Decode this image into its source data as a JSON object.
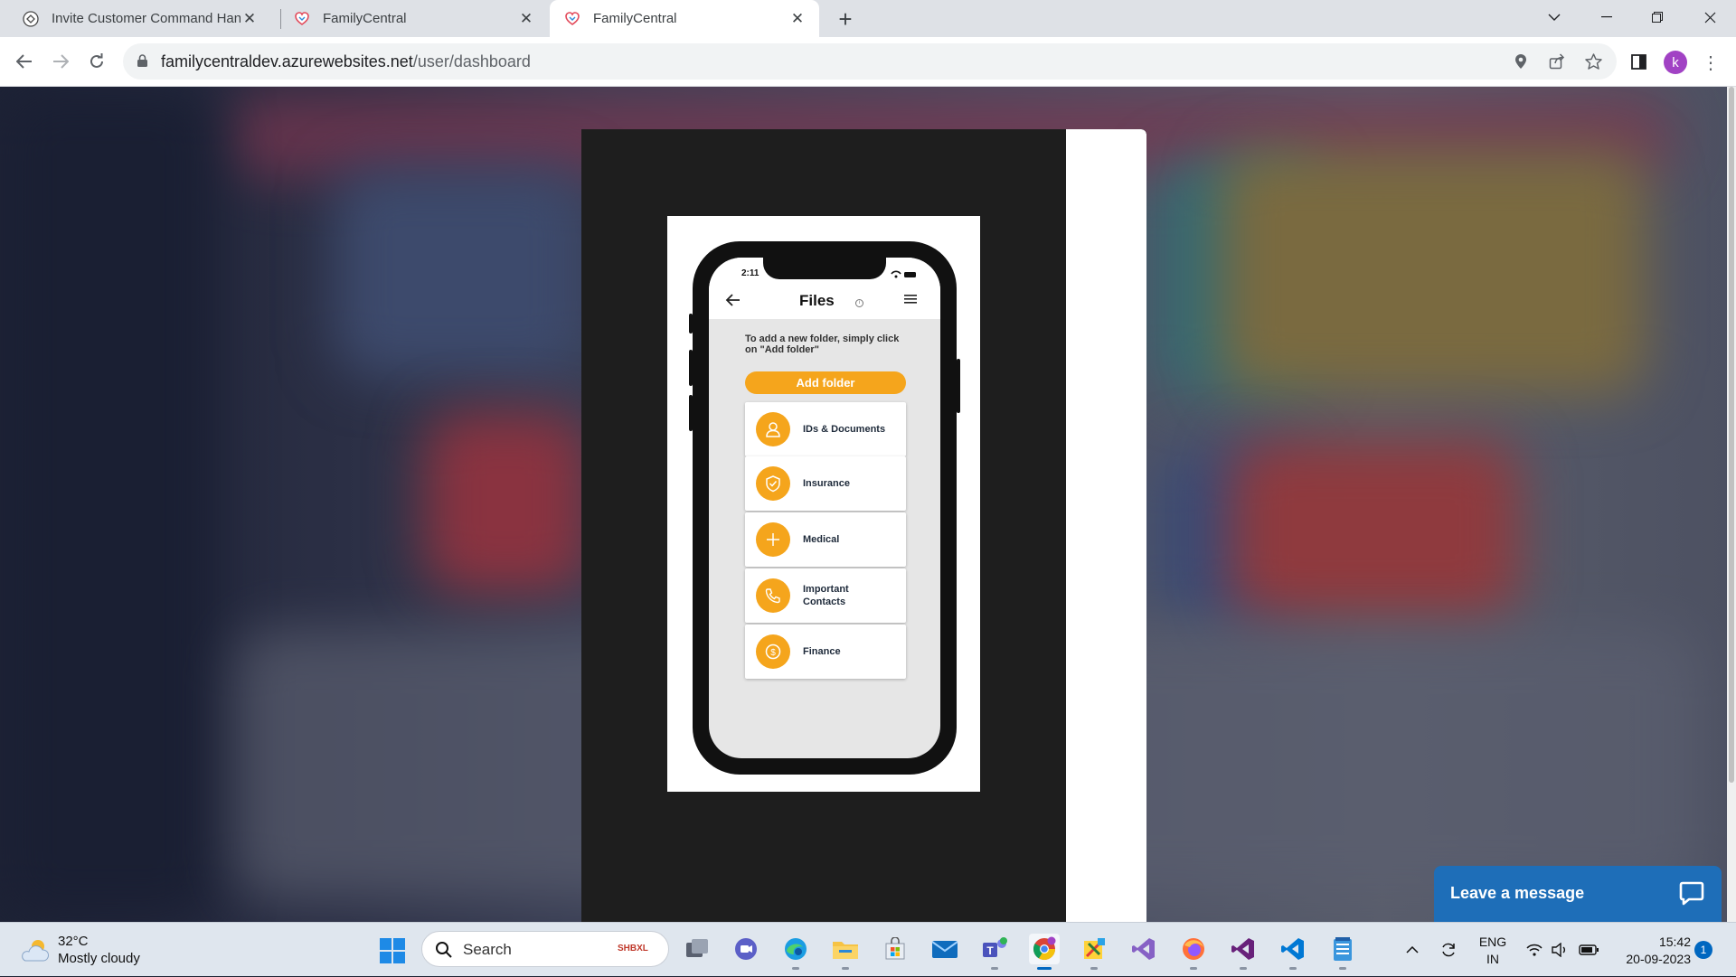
{
  "browser": {
    "tabs": [
      {
        "title": "Invite Customer Command Hand",
        "favicon": "chatgpt-icon",
        "active": false
      },
      {
        "title": "FamilyCentral",
        "favicon": "familycentral-heart-icon",
        "active": false
      },
      {
        "title": "FamilyCentral",
        "favicon": "familycentral-heart-icon",
        "active": true
      }
    ],
    "new_tab_label": "+",
    "url_host": "familycentraldev.azurewebsites.net",
    "url_path": "/user/dashboard",
    "profile_initial": "k"
  },
  "phone": {
    "time": "2:11",
    "title": "Files",
    "hint": "To add a new folder, simply click on \"Add folder\"",
    "add_folder_label": "Add folder",
    "folders": [
      {
        "label": "IDs & Documents",
        "icon": "person-icon"
      },
      {
        "label": "Insurance",
        "icon": "shield-check-icon"
      },
      {
        "label": "Medical",
        "icon": "plus-icon"
      },
      {
        "label": "Important Contacts",
        "icon": "phone-icon"
      },
      {
        "label": "Finance",
        "icon": "dollar-coin-icon"
      }
    ]
  },
  "chat_widget": {
    "label": "Leave a message",
    "icon": "chat-bubble-icon"
  },
  "taskbar": {
    "weather_temp": "32°C",
    "weather_desc": "Mostly cloudy",
    "search_label": "Search",
    "search_badge": "SHBXL",
    "lang_line1": "ENG",
    "lang_line2": "IN",
    "time": "15:42",
    "date": "20-09-2023",
    "notification_count": "1",
    "apps": [
      "task-view-icon",
      "teams-chat-icon",
      "edge-icon",
      "file-explorer-icon",
      "microsoft-store-icon",
      "mail-icon",
      "teams-icon",
      "chrome-icon",
      "paint-tools-icon",
      "visual-studio-icon",
      "firefox-icon",
      "visual-studio-alt-icon",
      "vscode-icon",
      "notepad-icon"
    ]
  },
  "colors": {
    "accent_orange": "#f5a51c",
    "chat_blue": "#1e6eb8",
    "profile_purple": "#a142c4"
  }
}
